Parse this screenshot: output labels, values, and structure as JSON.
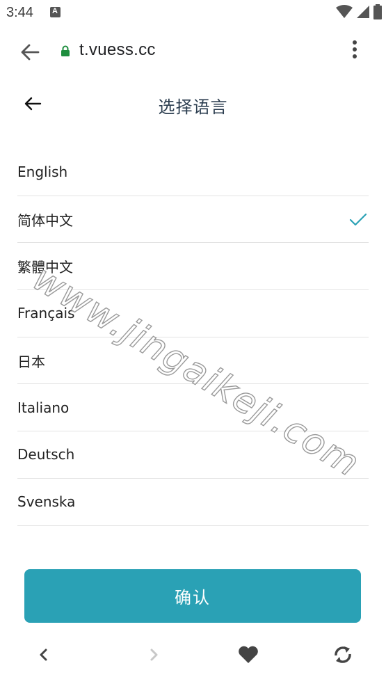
{
  "status_bar": {
    "time": "3:44",
    "notification_letter": "A"
  },
  "browser": {
    "url": "t.vuess.cc"
  },
  "header": {
    "title": "选择语言"
  },
  "languages": [
    {
      "label": "English",
      "selected": false
    },
    {
      "label": "简体中文",
      "selected": true
    },
    {
      "label": "繁體中文",
      "selected": false
    },
    {
      "label": "Français",
      "selected": false
    },
    {
      "label": "日本",
      "selected": false
    },
    {
      "label": "Italiano",
      "selected": false
    },
    {
      "label": "Deutsch",
      "selected": false
    },
    {
      "label": "Svenska",
      "selected": false
    }
  ],
  "confirm_label": "确认",
  "watermark": "www.jingaikeji.com",
  "colors": {
    "accent": "#2aa1b5",
    "check": "#2aa1b5",
    "lock": "#1e8e3e"
  },
  "icons": {
    "browser_back": "arrow-left-icon",
    "lock": "lock-icon",
    "menu": "more-vert-icon",
    "header_back": "arrow-left-icon",
    "check": "check-icon",
    "nav_back": "chevron-left-icon",
    "nav_forward": "chevron-right-icon",
    "favorite": "heart-icon",
    "refresh": "refresh-icon"
  }
}
